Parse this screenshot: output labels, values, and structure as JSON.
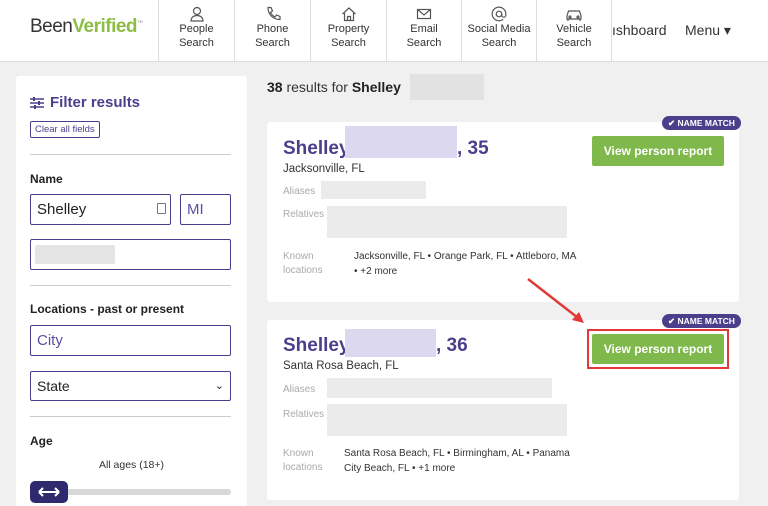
{
  "header": {
    "logo_been": "Been",
    "logo_verified": "Verified",
    "logo_tm": "™",
    "nav": [
      {
        "line1": "People",
        "line2": "Search",
        "icon": "person-icon"
      },
      {
        "line1": "Phone",
        "line2": "Search",
        "icon": "phone-icon"
      },
      {
        "line1": "Property",
        "line2": "Search",
        "icon": "house-icon"
      },
      {
        "line1": "Email",
        "line2": "Search",
        "icon": "mail-icon"
      },
      {
        "line1": "Social Media",
        "line2": "Search",
        "icon": "at-icon"
      },
      {
        "line1": "Vehicle",
        "line2": "Search",
        "icon": "car-icon"
      }
    ],
    "dashboard_label": "ıshboard",
    "menu_label": "Menu ▾"
  },
  "sidebar": {
    "title": "Filter results",
    "clear_label": "Clear all fields",
    "name_label": "Name",
    "first_name_value": "Shelley",
    "middle_initial_placeholder": "MI",
    "locations_label": "Locations - past or present",
    "city_placeholder": "City",
    "state_value": "State",
    "age_label": "Age",
    "ages_value": "All ages (18+)"
  },
  "results": {
    "count": "38",
    "count_text": " results for ",
    "query_name": "Shelley",
    "cards": [
      {
        "first_name": "Shelley",
        "age": ", 35",
        "city": "Jacksonville, FL",
        "badge": "✔ NAME MATCH",
        "button": "View person report",
        "aliases_label": "Aliases",
        "relatives_label": "Relatives",
        "known_label_1": "Known",
        "known_label_2": "locations",
        "locations_line1": "Jacksonville, FL • Orange Park, FL • Attleboro, MA",
        "locations_line2": "• +2 more"
      },
      {
        "first_name": "Shelley",
        "age": ", 36",
        "city": "Santa Rosa Beach, FL",
        "badge": "✔ NAME MATCH",
        "button": "View person report",
        "aliases_label": "Aliases",
        "relatives_label": "Relatives",
        "known_label_1": "Known",
        "known_label_2": "locations",
        "locations_line1": "Santa Rosa Beach, FL • Birmingham, AL • Panama",
        "locations_line2": "City Beach, FL • +1 more"
      }
    ]
  },
  "colors": {
    "brand_purple": "#4b3f8c",
    "brand_green": "#7fb84b",
    "highlight_red": "#e23838"
  }
}
